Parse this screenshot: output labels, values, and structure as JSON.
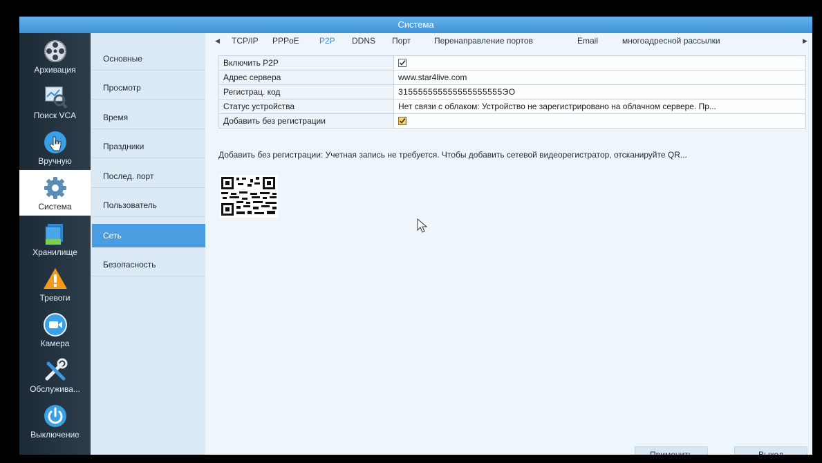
{
  "window": {
    "title": "Система"
  },
  "leftbar": {
    "items": [
      {
        "label": "Архивация",
        "icon": "reel-icon"
      },
      {
        "label": "Поиск VCA",
        "icon": "search-chart-icon"
      },
      {
        "label": "Вручную",
        "icon": "hand-icon"
      },
      {
        "label": "Система",
        "icon": "gear-icon"
      },
      {
        "label": "Хранилище",
        "icon": "storage-icon"
      },
      {
        "label": "Тревоги",
        "icon": "warning-icon"
      },
      {
        "label": "Камера",
        "icon": "camera-icon"
      },
      {
        "label": "Обслужива...",
        "icon": "tools-icon"
      },
      {
        "label": "Выключение",
        "icon": "power-icon"
      }
    ],
    "active": "Система"
  },
  "submenu": {
    "items": [
      "Основные",
      "Просмотр",
      "Время",
      "Праздники",
      "Послед. порт",
      "Пользователь",
      "Сеть",
      "Безопасность"
    ],
    "active": "Сеть"
  },
  "tabs": {
    "items": [
      "TCP/IP",
      "PPPoE",
      "P2P",
      "DDNS",
      "Порт",
      "Перенаправление портов",
      "Email",
      "многоадресной рассылки"
    ],
    "active": "P2P"
  },
  "p2p": {
    "enable_label": "Включить P2P",
    "enable_checked": true,
    "server_label": "Адрес сервера",
    "server_value": "www.star4live.com",
    "reg_label": "Регистрац. код",
    "reg_value": "315555555555555555555ЭO",
    "status_label": "Статус устройства",
    "status_value": "Нет связи с облаком: Устройство не зарегистрировано на облачном сервере. Пр...",
    "noreg_label": "Добавить без регистрации",
    "noreg_checked": true
  },
  "note": "Добавить без регистрации: Учетная запись не требуется. Чтобы добавить сетевой видеорегистратор, отсканируйте QR...",
  "buttons": {
    "apply": "Применить",
    "exit": "Выход"
  },
  "colors": {
    "accent": "#4a9de0",
    "titlebar": "#4c9fe0",
    "sidebar": "#24333f"
  }
}
